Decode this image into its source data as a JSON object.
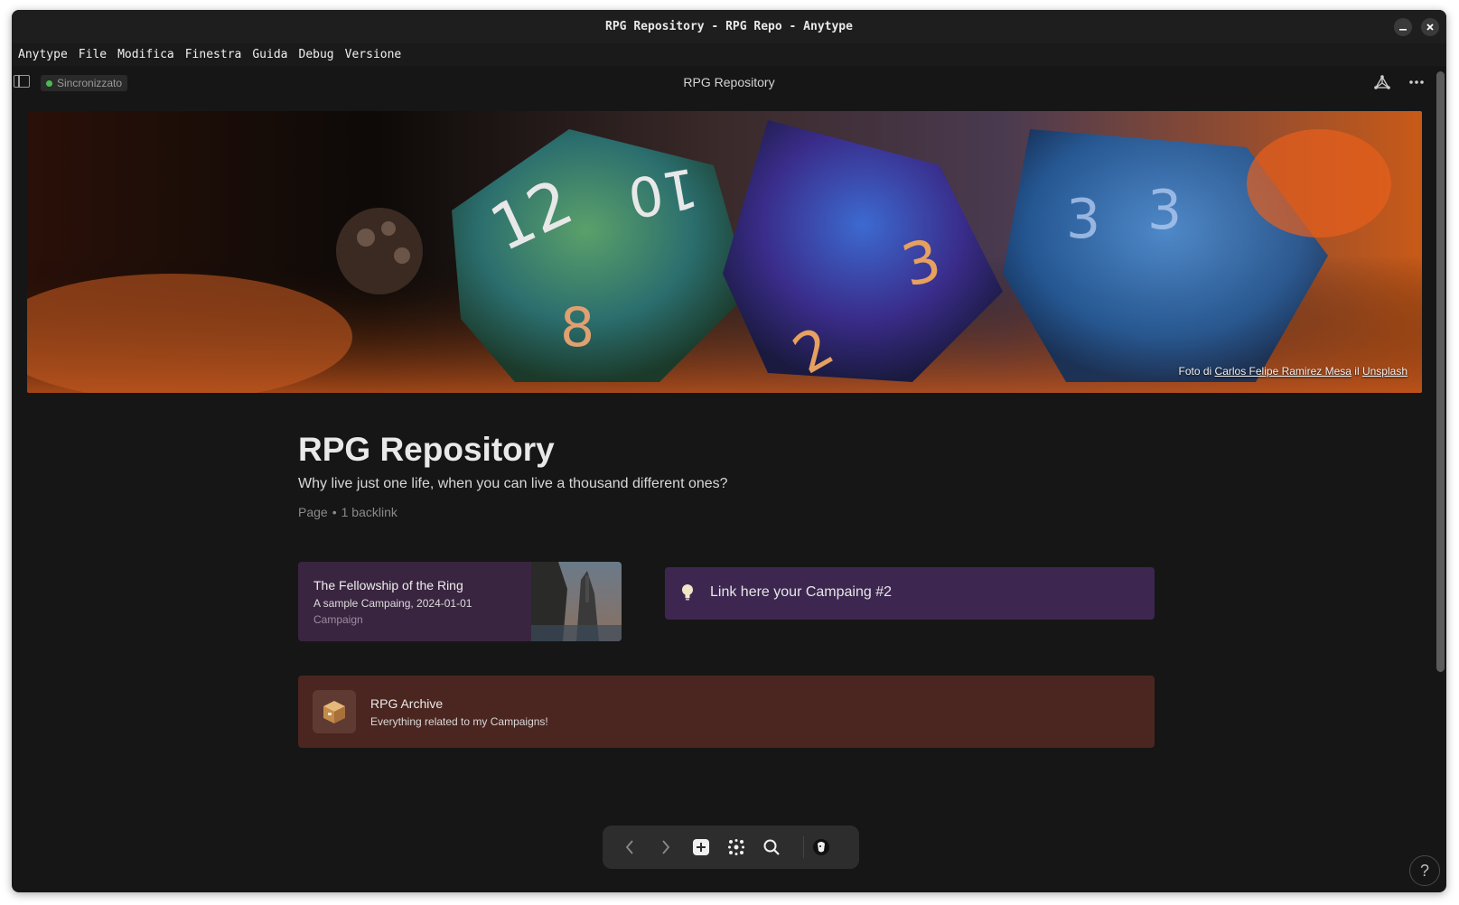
{
  "window": {
    "title": "RPG Repository - RPG Repo - Anytype",
    "minimize_icon": "minimize-icon",
    "close_icon": "close-icon"
  },
  "menu": [
    "Anytype",
    "File",
    "Modifica",
    "Finestra",
    "Guida",
    "Debug",
    "Versione"
  ],
  "header": {
    "sync_status": "Sincronizzato",
    "sync_color": "#4dbb52",
    "page_title": "RPG Repository"
  },
  "cover": {
    "credit_prefix": "Foto di",
    "photographer": "Carlos Felipe Ramirez Mesa",
    "credit_joiner": "il",
    "source": "Unsplash"
  },
  "page": {
    "title": "RPG Repository",
    "description": "Why live just one life, when you can live a thousand different ones?",
    "type": "Page",
    "backlinks": "1 backlink"
  },
  "links": {
    "campaign": {
      "name": "The Fellowship of the Ring",
      "description": "A sample Campaing, 2024-01-01",
      "type": "Campaign"
    },
    "callout": {
      "icon": "lightbulb-icon",
      "text": "Link here your Campaing #2"
    },
    "archive": {
      "icon": "package-icon",
      "name": "RPG Archive",
      "description": "Everything related to my Campaigns!"
    }
  },
  "navbar": {
    "items": [
      "back-icon",
      "forward-icon",
      "add-icon",
      "graph-icon",
      "search-icon",
      "profile-icon"
    ]
  },
  "help_label": "?"
}
